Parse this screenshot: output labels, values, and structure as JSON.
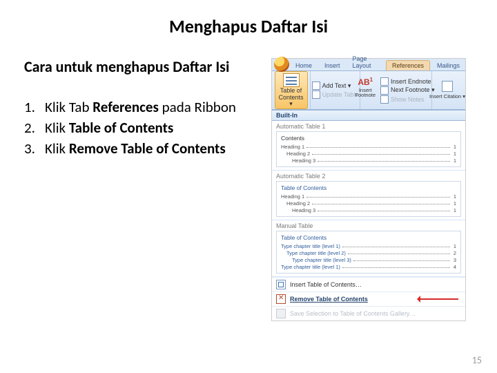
{
  "title": "Menghapus Daftar Isi",
  "subtitle": "Cara untuk menghapus Daftar Isi",
  "steps": [
    {
      "pre": "Klik Tab ",
      "bold": "References",
      "post": " pada Ribbon"
    },
    {
      "pre": "Klik ",
      "bold": "Table of Contents",
      "post": ""
    },
    {
      "pre": "Klik ",
      "bold": "Remove Table of Contents",
      "post": ""
    }
  ],
  "ribbon": {
    "tabs": [
      "Home",
      "Insert",
      "Page Layout",
      "References",
      "Mailings"
    ],
    "active_tab": "References",
    "toc_label_1": "Table of",
    "toc_label_2": "Contents ▾",
    "add_text": "Add Text ▾",
    "update_table": "Update Table",
    "insert_endnote": "Insert Endnote",
    "next_footnote": "Next Footnote ▾",
    "show_notes": "Show Notes",
    "insert_footnote": "Insert Footnote",
    "ab_label": "AB",
    "ab_sup": "1",
    "insert_citation": "Insert Citation ▾"
  },
  "gallery": {
    "built_in": "Built-In",
    "rows": [
      {
        "title": "Automatic Table 1",
        "pv_title": "Contents",
        "pv_style": "blk",
        "lines": [
          "Heading 1",
          "Heading 2",
          "Heading 3"
        ]
      },
      {
        "title": "Automatic Table 2",
        "pv_title": "Table of Contents",
        "pv_style": "",
        "lines": [
          "Heading 1",
          "Heading 2",
          "Heading 3"
        ]
      },
      {
        "title": "Manual Table",
        "pv_title": "Table of Contents",
        "pv_style": "",
        "manual": true,
        "lines": [
          "Type chapter title (level 1)",
          "Type chapter title (level 2)",
          "Type chapter title (level 3)",
          "Type chapter title (level 1)"
        ]
      }
    ],
    "pg": "1"
  },
  "commands": {
    "insert": "Insert Table of Contents…",
    "remove": "Remove Table of Contents",
    "save": "Save Selection to Table of Contents Gallery…"
  },
  "page_number": "15"
}
